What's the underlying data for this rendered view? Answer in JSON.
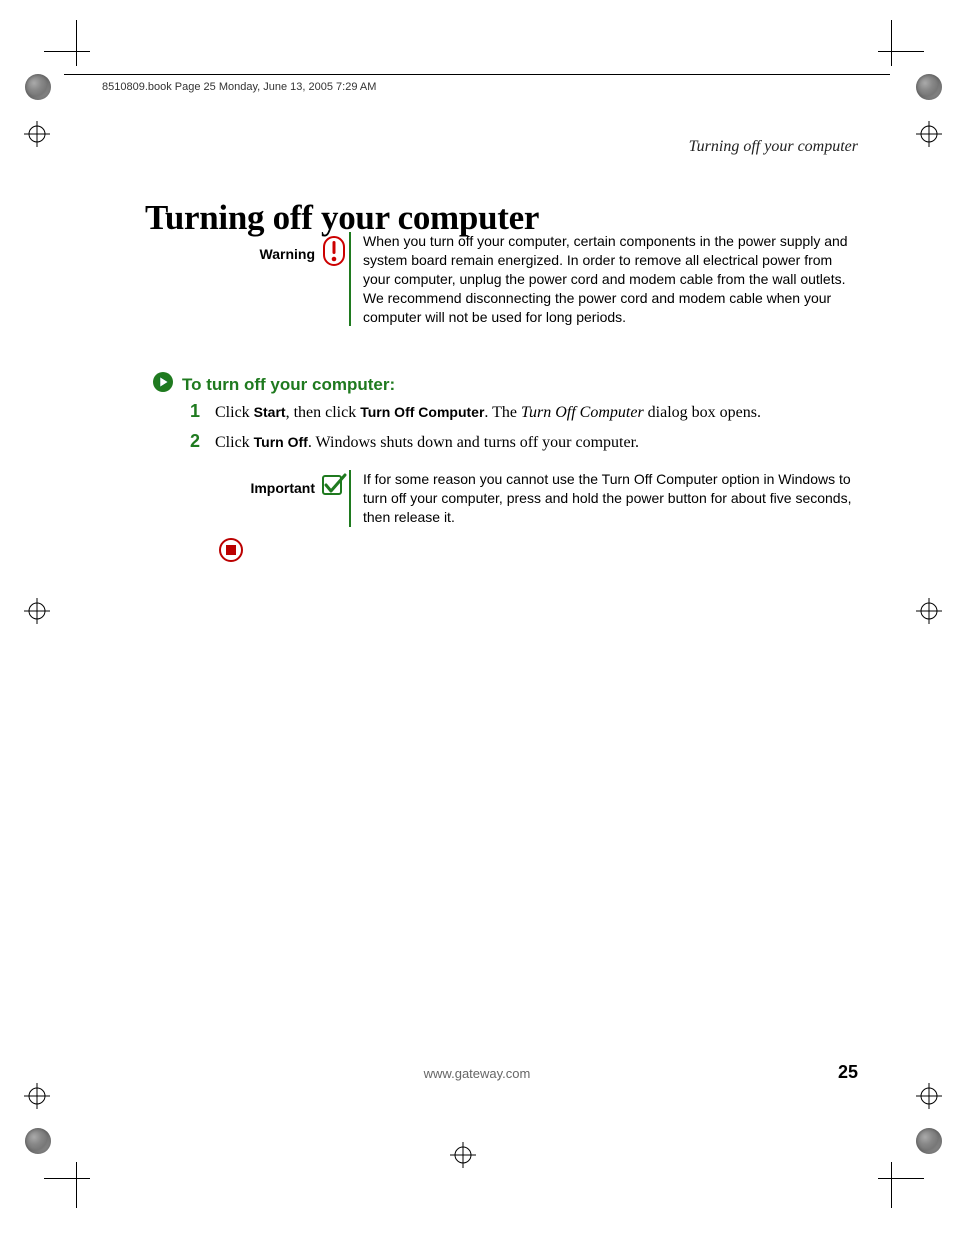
{
  "header_meta": "8510809.book  Page 25  Monday, June 13, 2005  7:29 AM",
  "running_head": "Turning off your computer",
  "page_title": "Turning off your computer",
  "warning": {
    "label": "Warning",
    "text": "When you turn off your computer, certain components in the power supply and system board remain energized. In order to remove all electrical power from your computer, unplug the power cord and modem cable from the wall outlets. We recommend disconnecting the power cord and modem cable when your computer will not be used for long periods."
  },
  "section_head": "To turn off your computer:",
  "steps": [
    {
      "num": "1",
      "pre": "Click ",
      "b1": "Start",
      "mid1": ", then click ",
      "b2": "Turn Off Computer",
      "mid2": ". The ",
      "ital": "Turn Off Computer",
      "post": " dialog box opens."
    },
    {
      "num": "2",
      "pre": "Click ",
      "b1": "Turn Off",
      "mid1": ". Windows shuts down and turns off your computer.",
      "b2": "",
      "mid2": "",
      "ital": "",
      "post": ""
    }
  ],
  "important": {
    "label": "Important",
    "text": "If for some reason you cannot use the Turn Off Computer option in Windows to turn off your computer, press and hold the power button for about five seconds, then release it."
  },
  "footer_url": "www.gateway.com",
  "page_number": "25"
}
